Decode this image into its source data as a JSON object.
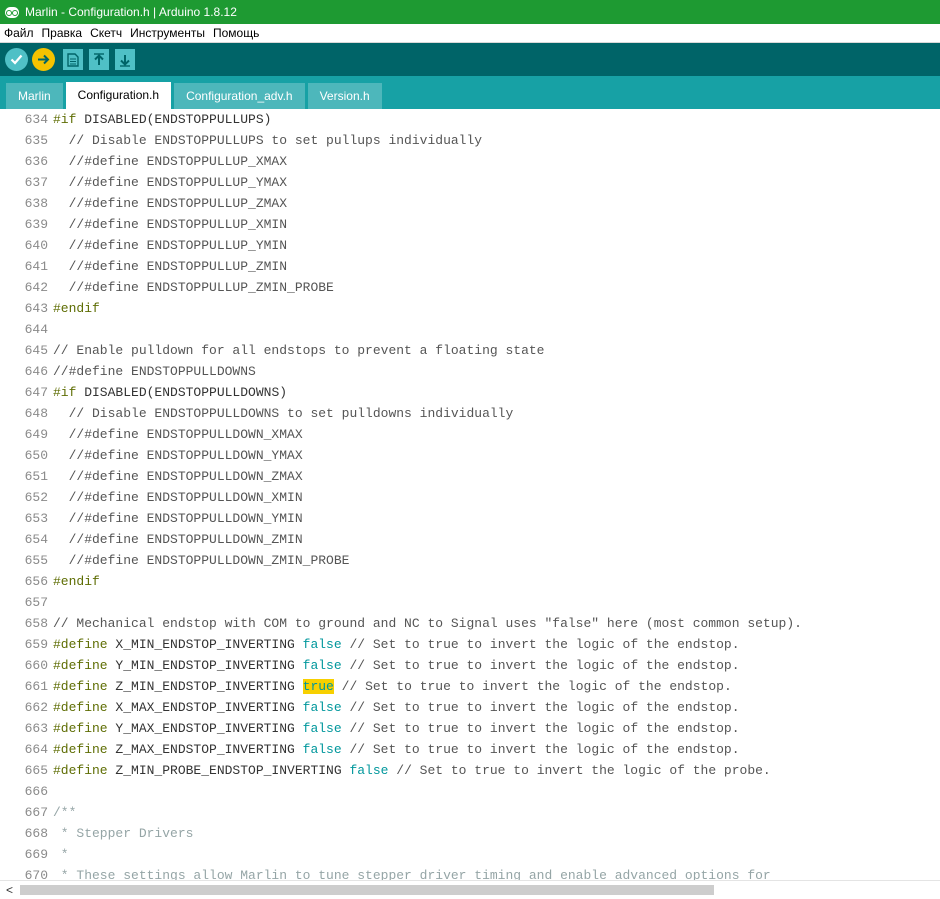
{
  "window": {
    "title": "Marlin - Configuration.h | Arduino 1.8.12"
  },
  "menu": [
    "Файл",
    "Правка",
    "Скетч",
    "Инструменты",
    "Помощь"
  ],
  "toolbar": {
    "buttons": [
      {
        "name": "verify-button",
        "icon": "checkmark-icon",
        "color": "#4fc0c6"
      },
      {
        "name": "upload-button",
        "icon": "arrow-right-icon",
        "color": "#f5c300"
      },
      {
        "name": "new-button",
        "icon": "new-file-icon",
        "color": "#4fc0c6"
      },
      {
        "name": "open-button",
        "icon": "arrow-up-icon",
        "color": "#4fc0c6"
      },
      {
        "name": "save-button",
        "icon": "arrow-down-icon",
        "color": "#4fc0c6"
      }
    ]
  },
  "tabs": [
    {
      "label": "Marlin",
      "active": false
    },
    {
      "label": "Configuration.h",
      "active": true
    },
    {
      "label": "Configuration_adv.h",
      "active": false
    },
    {
      "label": "Version.h",
      "active": false
    }
  ],
  "editor": {
    "lines": [
      {
        "n": "634",
        "segs": [
          [
            "pp",
            "#if"
          ],
          [
            "",
            "DISABLED(ENDSTOPPULLUPS)"
          ]
        ]
      },
      {
        "n": "635",
        "segs": [
          [
            "cm",
            "  // Disable ENDSTOPPULLUPS to set pullups individually"
          ]
        ]
      },
      {
        "n": "636",
        "segs": [
          [
            "cm",
            "  //#define ENDSTOPPULLUP_XMAX"
          ]
        ]
      },
      {
        "n": "637",
        "segs": [
          [
            "cm",
            "  //#define ENDSTOPPULLUP_YMAX"
          ]
        ]
      },
      {
        "n": "638",
        "segs": [
          [
            "cm",
            "  //#define ENDSTOPPULLUP_ZMAX"
          ]
        ]
      },
      {
        "n": "639",
        "segs": [
          [
            "cm",
            "  //#define ENDSTOPPULLUP_XMIN"
          ]
        ]
      },
      {
        "n": "640",
        "segs": [
          [
            "cm",
            "  //#define ENDSTOPPULLUP_YMIN"
          ]
        ]
      },
      {
        "n": "641",
        "segs": [
          [
            "cm",
            "  //#define ENDSTOPPULLUP_ZMIN"
          ]
        ]
      },
      {
        "n": "642",
        "segs": [
          [
            "cm",
            "  //#define ENDSTOPPULLUP_ZMIN_PROBE"
          ]
        ]
      },
      {
        "n": "643",
        "segs": [
          [
            "pp",
            "#endif"
          ]
        ]
      },
      {
        "n": "644",
        "segs": []
      },
      {
        "n": "645",
        "segs": [
          [
            "cm",
            "// Enable pulldown for all endstops to prevent a floating state"
          ]
        ]
      },
      {
        "n": "646",
        "segs": [
          [
            "cm",
            "//#define ENDSTOPPULLDOWNS"
          ]
        ]
      },
      {
        "n": "647",
        "segs": [
          [
            "pp",
            "#if"
          ],
          [
            "",
            "DISABLED(ENDSTOPPULLDOWNS)"
          ]
        ]
      },
      {
        "n": "648",
        "segs": [
          [
            "cm",
            "  // Disable ENDSTOPPULLDOWNS to set pulldowns individually"
          ]
        ]
      },
      {
        "n": "649",
        "segs": [
          [
            "cm",
            "  //#define ENDSTOPPULLDOWN_XMAX"
          ]
        ]
      },
      {
        "n": "650",
        "segs": [
          [
            "cm",
            "  //#define ENDSTOPPULLDOWN_YMAX"
          ]
        ]
      },
      {
        "n": "651",
        "segs": [
          [
            "cm",
            "  //#define ENDSTOPPULLDOWN_ZMAX"
          ]
        ]
      },
      {
        "n": "652",
        "segs": [
          [
            "cm",
            "  //#define ENDSTOPPULLDOWN_XMIN"
          ]
        ]
      },
      {
        "n": "653",
        "segs": [
          [
            "cm",
            "  //#define ENDSTOPPULLDOWN_YMIN"
          ]
        ]
      },
      {
        "n": "654",
        "segs": [
          [
            "cm",
            "  //#define ENDSTOPPULLDOWN_ZMIN"
          ]
        ]
      },
      {
        "n": "655",
        "segs": [
          [
            "cm",
            "  //#define ENDSTOPPULLDOWN_ZMIN_PROBE"
          ]
        ]
      },
      {
        "n": "656",
        "segs": [
          [
            "pp",
            "#endif"
          ]
        ]
      },
      {
        "n": "657",
        "segs": []
      },
      {
        "n": "658",
        "segs": [
          [
            "cm",
            "// Mechanical endstop with COM to ground and NC to Signal uses \"false\" here (most common setup)."
          ]
        ]
      },
      {
        "n": "659",
        "segs": [
          [
            "pp",
            "#define"
          ],
          [
            "",
            " X_MIN_ENDSTOP_INVERTING "
          ],
          [
            "kw",
            "false"
          ],
          [
            "cm",
            " // Set to true to invert the logic of the endstop."
          ]
        ]
      },
      {
        "n": "660",
        "segs": [
          [
            "pp",
            "#define"
          ],
          [
            "",
            " Y_MIN_ENDSTOP_INVERTING "
          ],
          [
            "kw",
            "false"
          ],
          [
            "cm",
            " // Set to true to invert the logic of the endstop."
          ]
        ]
      },
      {
        "n": "661",
        "segs": [
          [
            "pp",
            "#define"
          ],
          [
            "",
            " Z_MIN_ENDSTOP_INVERTING "
          ],
          [
            "kw hl",
            "true"
          ],
          [
            "cm",
            " // Set to true to invert the logic of the endstop."
          ]
        ]
      },
      {
        "n": "662",
        "segs": [
          [
            "pp",
            "#define"
          ],
          [
            "",
            " X_MAX_ENDSTOP_INVERTING "
          ],
          [
            "kw",
            "false"
          ],
          [
            "cm",
            " // Set to true to invert the logic of the endstop."
          ]
        ]
      },
      {
        "n": "663",
        "segs": [
          [
            "pp",
            "#define"
          ],
          [
            "",
            " Y_MAX_ENDSTOP_INVERTING "
          ],
          [
            "kw",
            "false"
          ],
          [
            "cm",
            " // Set to true to invert the logic of the endstop."
          ]
        ]
      },
      {
        "n": "664",
        "segs": [
          [
            "pp",
            "#define"
          ],
          [
            "",
            " Z_MAX_ENDSTOP_INVERTING "
          ],
          [
            "kw",
            "false"
          ],
          [
            "cm",
            " // Set to true to invert the logic of the endstop."
          ]
        ]
      },
      {
        "n": "665",
        "segs": [
          [
            "pp",
            "#define"
          ],
          [
            "",
            " Z_MIN_PROBE_ENDSTOP_INVERTING "
          ],
          [
            "kw",
            "false"
          ],
          [
            "cm",
            " // Set to true to invert the logic of the probe."
          ]
        ]
      },
      {
        "n": "666",
        "segs": []
      },
      {
        "n": "667",
        "segs": [
          [
            "dc",
            "/**"
          ]
        ]
      },
      {
        "n": "668",
        "segs": [
          [
            "dc",
            " * Stepper Drivers"
          ]
        ]
      },
      {
        "n": "669",
        "segs": [
          [
            "dc",
            " *"
          ]
        ]
      },
      {
        "n": "670",
        "segs": [
          [
            "dc",
            " * These settings allow Marlin to tune stepper driver timing and enable advanced options for"
          ]
        ]
      }
    ]
  },
  "colors": {
    "titlebar": "#1e9a32",
    "toolbar": "#006468",
    "tabbar": "#17a1a5",
    "highlight": "#f7d000"
  }
}
